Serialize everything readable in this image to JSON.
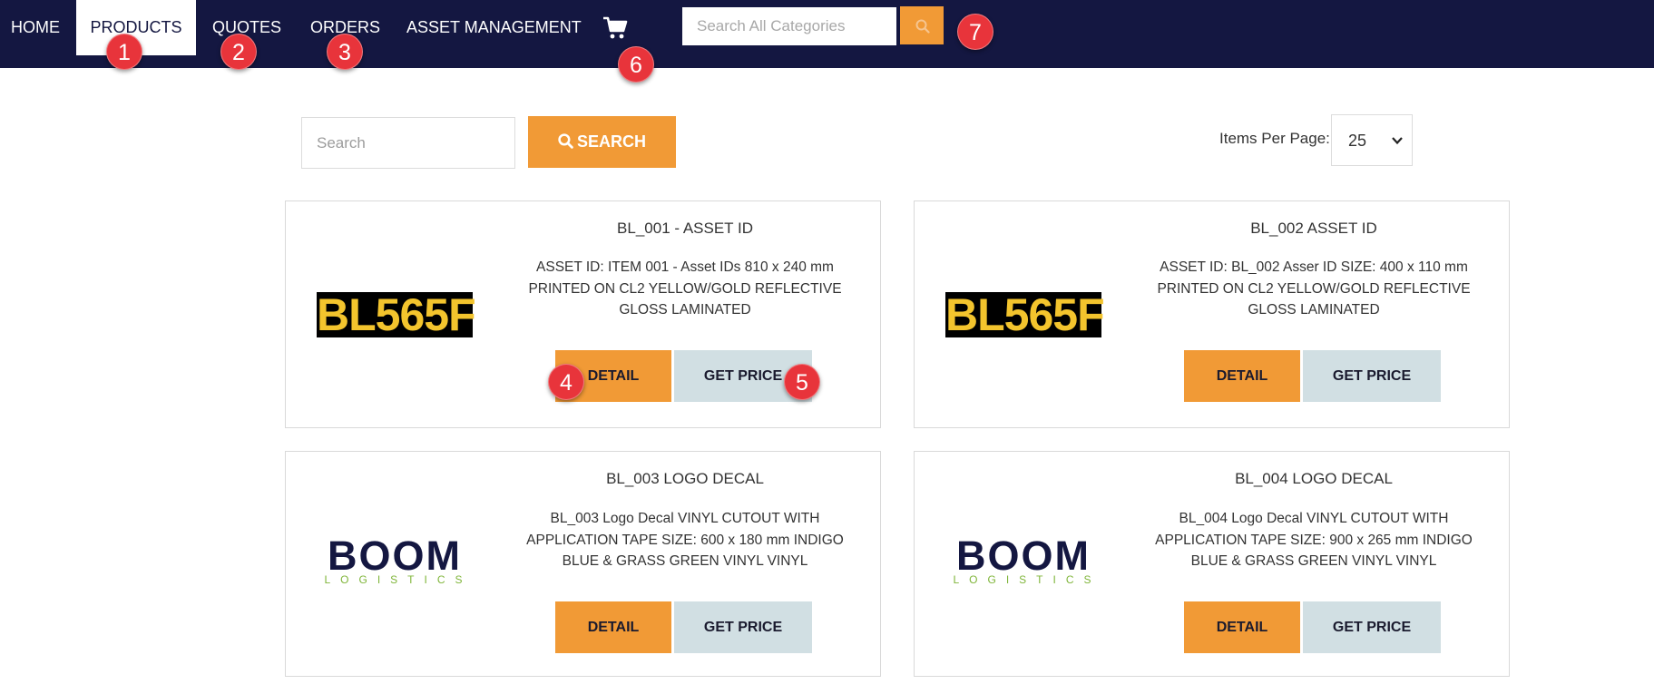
{
  "nav": {
    "home": "HOME",
    "products": "PRODUCTS",
    "quotes": "QUOTES",
    "orders": "ORDERS",
    "asset_management": "ASSET MANAGEMENT",
    "search_placeholder": "Search All Categories",
    "cart_icon": "shopping-cart-icon"
  },
  "toolbar": {
    "search_placeholder": "Search",
    "search_button": "SEARCH",
    "items_per_page_label": "Items Per Page:",
    "items_per_page_value": "25"
  },
  "products": [
    {
      "title": "BL_001 - ASSET ID",
      "description": "ASSET ID: ITEM 001 - Asset IDs 810 x 240 mm PRINTED ON CL2 YELLOW/GOLD REFLECTIVE GLOSS LAMINATED",
      "image_text": "BL565F",
      "detail_label": "DETAIL",
      "price_label": "GET PRICE"
    },
    {
      "title": "BL_002 ASSET ID",
      "description": "ASSET ID: BL_002 Asser ID SIZE: 400 x 110 mm PRINTED ON CL2 YELLOW/GOLD REFLECTIVE GLOSS LAMINATED",
      "image_text": "BL565F",
      "detail_label": "DETAIL",
      "price_label": "GET PRICE"
    },
    {
      "title": "BL_003 LOGO DECAL",
      "description": "BL_003 Logo Decal VINYL CUTOUT WITH APPLICATION TAPE SIZE: 600 x 180 mm INDIGO BLUE & GRASS GREEN VINYL VINYL",
      "image_text": "BOOM",
      "image_subtext": "LOGISTICS",
      "detail_label": "DETAIL",
      "price_label": "GET PRICE"
    },
    {
      "title": "BL_004 LOGO DECAL",
      "description": "BL_004 Logo Decal VINYL CUTOUT WITH APPLICATION TAPE SIZE: 900 x 265 mm INDIGO BLUE & GRASS GREEN VINYL VINYL",
      "image_text": "BOOM",
      "image_subtext": "LOGISTICS",
      "detail_label": "DETAIL",
      "price_label": "GET PRICE"
    }
  ],
  "badges": [
    "1",
    "2",
    "3",
    "4",
    "5",
    "6",
    "7"
  ],
  "colors": {
    "nav_bg": "#141741",
    "accent_orange": "#f19a36",
    "price_button": "#d1dfe3",
    "badge_red": "#e8343b",
    "plate_yellow": "#f3c42d",
    "boom_green": "#7fb539"
  }
}
